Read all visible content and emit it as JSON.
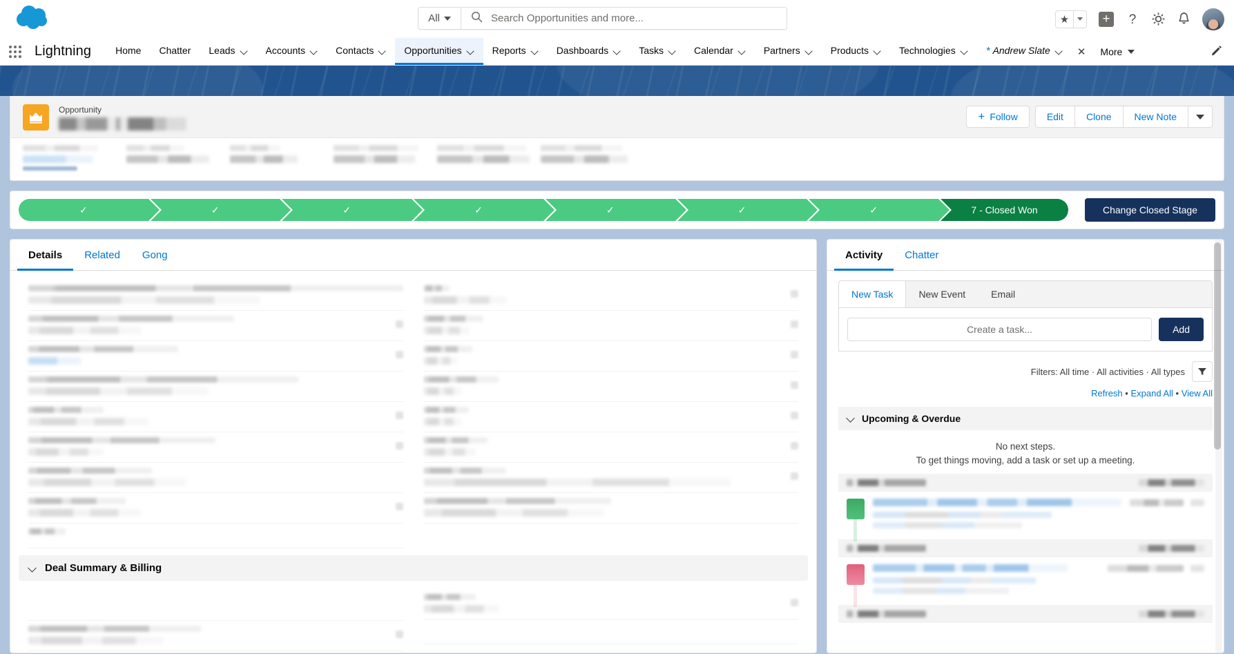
{
  "header": {
    "search": {
      "scope": "All",
      "placeholder": "Search Opportunities and more...",
      "value": ""
    },
    "icons": {
      "favorites": "star-icon",
      "favorites_caret": "chevron-down-icon",
      "global_actions": "plus-icon",
      "help": "question-mark-icon",
      "setup": "gear-icon",
      "notifications": "bell-icon",
      "profile": "user-avatar"
    }
  },
  "nav": {
    "app_launcher": "app-launcher-icon",
    "app_name": "Lightning",
    "items": [
      {
        "label": "Home",
        "caret": false,
        "active": false
      },
      {
        "label": "Chatter",
        "caret": false,
        "active": false
      },
      {
        "label": "Leads",
        "caret": true,
        "active": false
      },
      {
        "label": "Accounts",
        "caret": true,
        "active": false
      },
      {
        "label": "Contacts",
        "caret": true,
        "active": false
      },
      {
        "label": "Opportunities",
        "caret": true,
        "active": true
      },
      {
        "label": "Reports",
        "caret": true,
        "active": false
      },
      {
        "label": "Dashboards",
        "caret": true,
        "active": false
      },
      {
        "label": "Tasks",
        "caret": true,
        "active": false
      },
      {
        "label": "Calendar",
        "caret": true,
        "active": false
      },
      {
        "label": "Partners",
        "caret": true,
        "active": false
      },
      {
        "label": "Products",
        "caret": true,
        "active": false
      },
      {
        "label": "Technologies",
        "caret": true,
        "active": false
      }
    ],
    "workspace_tab": {
      "dirty_marker": "*",
      "label": "Andrew Slate",
      "caret": true,
      "close": "close-icon"
    },
    "more": {
      "label": "More",
      "caret": "triangle-down-icon"
    },
    "edit_nav": "pencil-icon"
  },
  "record": {
    "object_label": "Opportunity",
    "icon": "opportunity-crown-icon",
    "name_redacted": true,
    "actions": {
      "follow": "Follow",
      "edit": "Edit",
      "clone": "Clone",
      "new_note": "New Note",
      "more": "triangle-down-icon"
    },
    "highlight_fields": [
      {
        "label_redacted": true,
        "value_redacted": true,
        "link": true
      },
      {
        "label_redacted": true,
        "value_redacted": true,
        "link": false
      },
      {
        "label_redacted": true,
        "value_redacted": true,
        "link": false
      },
      {
        "label_redacted": true,
        "value_redacted": true,
        "link": false
      },
      {
        "label_redacted": true,
        "value_redacted": true,
        "link": false
      },
      {
        "label_redacted": true,
        "value_redacted": true,
        "link": false
      }
    ]
  },
  "path": {
    "steps": [
      {
        "check": "✓",
        "complete": true
      },
      {
        "check": "✓",
        "complete": true
      },
      {
        "check": "✓",
        "complete": true
      },
      {
        "check": "✓",
        "complete": true
      },
      {
        "check": "✓",
        "complete": true
      },
      {
        "check": "✓",
        "complete": true
      },
      {
        "check": "✓",
        "complete": true
      }
    ],
    "current_stage": "7 - Closed Won",
    "action_button": "Change Closed Stage",
    "colors": {
      "complete": "#4bca81",
      "current": "#0a8043",
      "button": "#16325c"
    }
  },
  "details": {
    "tabs": [
      {
        "label": "Details",
        "active": true
      },
      {
        "label": "Related",
        "active": false
      },
      {
        "label": "Gong",
        "active": false
      }
    ],
    "section_title": "Deal Summary & Billing",
    "fields_redacted": true
  },
  "activity": {
    "tabs": [
      {
        "label": "Activity",
        "active": true
      },
      {
        "label": "Chatter",
        "active": false
      }
    ],
    "composer_tabs": [
      {
        "label": "New Task",
        "active": true
      },
      {
        "label": "New Event",
        "active": false
      },
      {
        "label": "Email",
        "active": false
      }
    ],
    "task_placeholder": "Create a task...",
    "add_button": "Add",
    "filters_text": "Filters: All time · All activities · All types",
    "filter_icon": "funnel-icon",
    "links": {
      "refresh": "Refresh",
      "expand_all": "Expand All",
      "view_all": "View All",
      "separator": "•"
    },
    "upcoming_group": "Upcoming & Overdue",
    "empty_state": {
      "line1": "No next steps.",
      "line2": "To get things moving, add a task or set up a meeting."
    },
    "timeline_redacted": true
  },
  "colors": {
    "brand_blue": "#0176d3",
    "navy": "#16325c",
    "banner_blue": "#21548e",
    "path_green": "#4bca81",
    "path_won_green": "#0a8043",
    "opportunity_orange": "#f5a623",
    "page_bg": "#b0c4de"
  }
}
